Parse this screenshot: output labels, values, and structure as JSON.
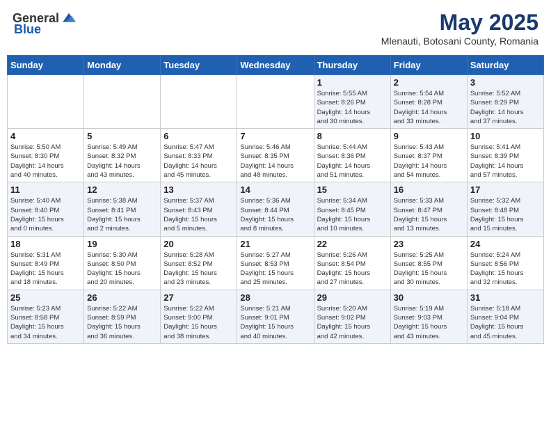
{
  "header": {
    "logo_general": "General",
    "logo_blue": "Blue",
    "month": "May 2025",
    "location": "Mlenauti, Botosani County, Romania"
  },
  "weekdays": [
    "Sunday",
    "Monday",
    "Tuesday",
    "Wednesday",
    "Thursday",
    "Friday",
    "Saturday"
  ],
  "weeks": [
    [
      {
        "day": "",
        "info": ""
      },
      {
        "day": "",
        "info": ""
      },
      {
        "day": "",
        "info": ""
      },
      {
        "day": "",
        "info": ""
      },
      {
        "day": "1",
        "info": "Sunrise: 5:55 AM\nSunset: 8:26 PM\nDaylight: 14 hours\nand 30 minutes."
      },
      {
        "day": "2",
        "info": "Sunrise: 5:54 AM\nSunset: 8:28 PM\nDaylight: 14 hours\nand 33 minutes."
      },
      {
        "day": "3",
        "info": "Sunrise: 5:52 AM\nSunset: 8:29 PM\nDaylight: 14 hours\nand 37 minutes."
      }
    ],
    [
      {
        "day": "4",
        "info": "Sunrise: 5:50 AM\nSunset: 8:30 PM\nDaylight: 14 hours\nand 40 minutes."
      },
      {
        "day": "5",
        "info": "Sunrise: 5:49 AM\nSunset: 8:32 PM\nDaylight: 14 hours\nand 43 minutes."
      },
      {
        "day": "6",
        "info": "Sunrise: 5:47 AM\nSunset: 8:33 PM\nDaylight: 14 hours\nand 45 minutes."
      },
      {
        "day": "7",
        "info": "Sunrise: 5:46 AM\nSunset: 8:35 PM\nDaylight: 14 hours\nand 48 minutes."
      },
      {
        "day": "8",
        "info": "Sunrise: 5:44 AM\nSunset: 8:36 PM\nDaylight: 14 hours\nand 51 minutes."
      },
      {
        "day": "9",
        "info": "Sunrise: 5:43 AM\nSunset: 8:37 PM\nDaylight: 14 hours\nand 54 minutes."
      },
      {
        "day": "10",
        "info": "Sunrise: 5:41 AM\nSunset: 8:39 PM\nDaylight: 14 hours\nand 57 minutes."
      }
    ],
    [
      {
        "day": "11",
        "info": "Sunrise: 5:40 AM\nSunset: 8:40 PM\nDaylight: 15 hours\nand 0 minutes."
      },
      {
        "day": "12",
        "info": "Sunrise: 5:38 AM\nSunset: 8:41 PM\nDaylight: 15 hours\nand 2 minutes."
      },
      {
        "day": "13",
        "info": "Sunrise: 5:37 AM\nSunset: 8:43 PM\nDaylight: 15 hours\nand 5 minutes."
      },
      {
        "day": "14",
        "info": "Sunrise: 5:36 AM\nSunset: 8:44 PM\nDaylight: 15 hours\nand 8 minutes."
      },
      {
        "day": "15",
        "info": "Sunrise: 5:34 AM\nSunset: 8:45 PM\nDaylight: 15 hours\nand 10 minutes."
      },
      {
        "day": "16",
        "info": "Sunrise: 5:33 AM\nSunset: 8:47 PM\nDaylight: 15 hours\nand 13 minutes."
      },
      {
        "day": "17",
        "info": "Sunrise: 5:32 AM\nSunset: 8:48 PM\nDaylight: 15 hours\nand 15 minutes."
      }
    ],
    [
      {
        "day": "18",
        "info": "Sunrise: 5:31 AM\nSunset: 8:49 PM\nDaylight: 15 hours\nand 18 minutes."
      },
      {
        "day": "19",
        "info": "Sunrise: 5:30 AM\nSunset: 8:50 PM\nDaylight: 15 hours\nand 20 minutes."
      },
      {
        "day": "20",
        "info": "Sunrise: 5:28 AM\nSunset: 8:52 PM\nDaylight: 15 hours\nand 23 minutes."
      },
      {
        "day": "21",
        "info": "Sunrise: 5:27 AM\nSunset: 8:53 PM\nDaylight: 15 hours\nand 25 minutes."
      },
      {
        "day": "22",
        "info": "Sunrise: 5:26 AM\nSunset: 8:54 PM\nDaylight: 15 hours\nand 27 minutes."
      },
      {
        "day": "23",
        "info": "Sunrise: 5:25 AM\nSunset: 8:55 PM\nDaylight: 15 hours\nand 30 minutes."
      },
      {
        "day": "24",
        "info": "Sunrise: 5:24 AM\nSunset: 8:56 PM\nDaylight: 15 hours\nand 32 minutes."
      }
    ],
    [
      {
        "day": "25",
        "info": "Sunrise: 5:23 AM\nSunset: 8:58 PM\nDaylight: 15 hours\nand 34 minutes."
      },
      {
        "day": "26",
        "info": "Sunrise: 5:22 AM\nSunset: 8:59 PM\nDaylight: 15 hours\nand 36 minutes."
      },
      {
        "day": "27",
        "info": "Sunrise: 5:22 AM\nSunset: 9:00 PM\nDaylight: 15 hours\nand 38 minutes."
      },
      {
        "day": "28",
        "info": "Sunrise: 5:21 AM\nSunset: 9:01 PM\nDaylight: 15 hours\nand 40 minutes."
      },
      {
        "day": "29",
        "info": "Sunrise: 5:20 AM\nSunset: 9:02 PM\nDaylight: 15 hours\nand 42 minutes."
      },
      {
        "day": "30",
        "info": "Sunrise: 5:19 AM\nSunset: 9:03 PM\nDaylight: 15 hours\nand 43 minutes."
      },
      {
        "day": "31",
        "info": "Sunrise: 5:18 AM\nSunset: 9:04 PM\nDaylight: 15 hours\nand 45 minutes."
      }
    ]
  ]
}
